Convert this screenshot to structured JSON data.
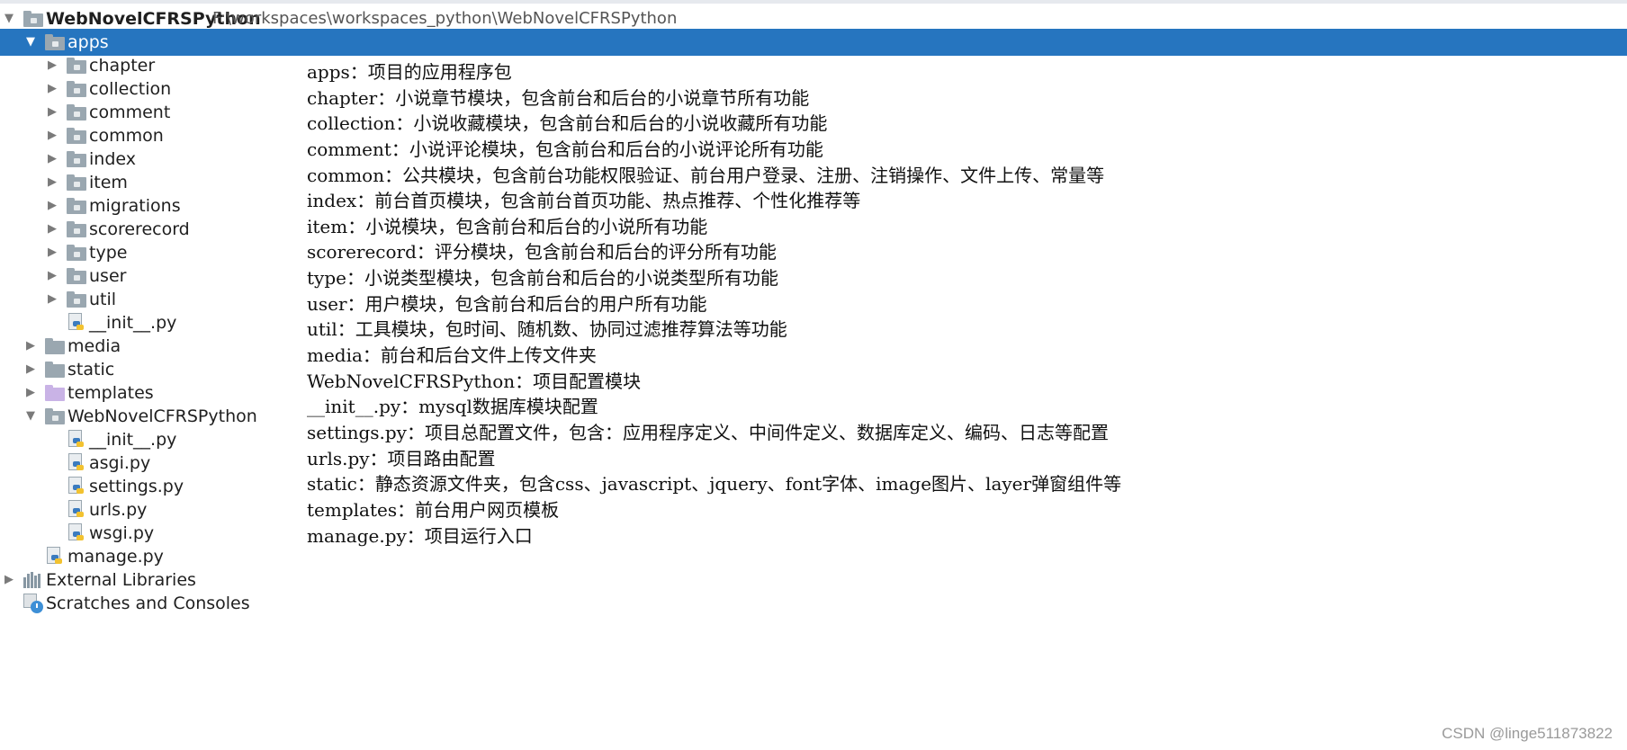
{
  "project": {
    "name": "WebNovelCFRSPython",
    "path": "F:\\workspaces\\workspaces_python\\WebNovelCFRSPython"
  },
  "tree": [
    {
      "label": "apps",
      "kind": "folder",
      "arrow": "down",
      "selected": true
    },
    {
      "label": "chapter",
      "kind": "folder",
      "arrow": "right"
    },
    {
      "label": "collection",
      "kind": "folder",
      "arrow": "right"
    },
    {
      "label": "comment",
      "kind": "folder",
      "arrow": "right"
    },
    {
      "label": "common",
      "kind": "folder",
      "arrow": "right"
    },
    {
      "label": "index",
      "kind": "folder",
      "arrow": "right"
    },
    {
      "label": "item",
      "kind": "folder",
      "arrow": "right"
    },
    {
      "label": "migrations",
      "kind": "folder",
      "arrow": "right"
    },
    {
      "label": "scorerecord",
      "kind": "folder",
      "arrow": "right"
    },
    {
      "label": "type",
      "kind": "folder",
      "arrow": "right"
    },
    {
      "label": "user",
      "kind": "folder",
      "arrow": "right"
    },
    {
      "label": "util",
      "kind": "folder",
      "arrow": "right"
    },
    {
      "label": "__init__.py",
      "kind": "python-file"
    },
    {
      "label": "media",
      "kind": "folder-plain",
      "arrow": "right"
    },
    {
      "label": "static",
      "kind": "folder-plain",
      "arrow": "right"
    },
    {
      "label": "templates",
      "kind": "folder-purple",
      "arrow": "right"
    },
    {
      "label": "WebNovelCFRSPython",
      "kind": "folder",
      "arrow": "down"
    },
    {
      "label": "__init__.py",
      "kind": "python-file"
    },
    {
      "label": "asgi.py",
      "kind": "python-file"
    },
    {
      "label": "settings.py",
      "kind": "python-file"
    },
    {
      "label": "urls.py",
      "kind": "python-file"
    },
    {
      "label": "wsgi.py",
      "kind": "python-file"
    },
    {
      "label": "manage.py",
      "kind": "python-file"
    },
    {
      "label": "External Libraries",
      "kind": "libraries",
      "arrow": "right"
    },
    {
      "label": "Scratches and Consoles",
      "kind": "scratches"
    }
  ],
  "notes": [
    "apps：项目的应用程序包",
    "chapter：小说章节模块，包含前台和后台的小说章节所有功能",
    "collection：小说收藏模块，包含前台和后台的小说收藏所有功能",
    "comment：小说评论模块，包含前台和后台的小说评论所有功能",
    "common：公共模块，包含前台功能权限验证、前台用户登录、注册、注销操作、文件上传、常量等",
    "index：前台首页模块，包含前台首页功能、热点推荐、个性化推荐等",
    "item：小说模块，包含前台和后台的小说所有功能",
    "scorerecord：评分模块，包含前台和后台的评分所有功能",
    "type：小说类型模块，包含前台和后台的小说类型所有功能",
    "user：用户模块，包含前台和后台的用户所有功能",
    "util：工具模块，包时间、随机数、协同过滤推荐算法等功能",
    "media：前台和后台文件上传文件夹",
    "WebNovelCFRSPython：项目配置模块",
    "__init__.py：mysql数据库模块配置",
    "settings.py：项目总配置文件，包含：应用程序定义、中间件定义、数据库定义、编码、日志等配置",
    "urls.py：项目路由配置",
    "static：静态资源文件夹，包含css、javascript、jquery、font字体、image图片、layer弹窗组件等",
    "templates：前台用户网页模板",
    "manage.py：项目运行入口"
  ],
  "watermark": "CSDN @linge511873822",
  "colors": {
    "selection": "#2675bf",
    "folder": "#9aa7b0",
    "templates_folder": "#c9b3e6"
  }
}
